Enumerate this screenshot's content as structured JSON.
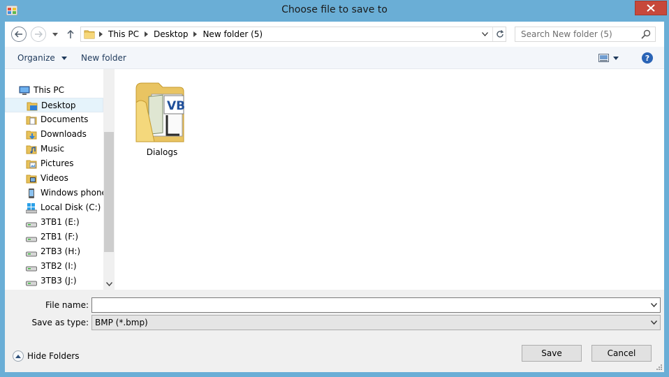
{
  "window": {
    "title": "Choose file to save to"
  },
  "address_bar": {
    "crumbs": [
      "This PC",
      "Desktop",
      "New folder (5)"
    ]
  },
  "search": {
    "placeholder": "Search New folder (5)"
  },
  "toolbar": {
    "organize_label": "Organize",
    "new_folder_label": "New folder"
  },
  "nav_tree": {
    "root": {
      "label": "This PC",
      "icon": "computer-icon"
    },
    "items": [
      {
        "label": "Desktop",
        "icon": "desktop-folder-icon",
        "selected": true
      },
      {
        "label": "Documents",
        "icon": "documents-folder-icon"
      },
      {
        "label": "Downloads",
        "icon": "downloads-folder-icon"
      },
      {
        "label": "Music",
        "icon": "music-folder-icon"
      },
      {
        "label": "Pictures",
        "icon": "pictures-folder-icon"
      },
      {
        "label": "Videos",
        "icon": "videos-folder-icon"
      },
      {
        "label": "Windows phone",
        "icon": "phone-icon"
      },
      {
        "label": "Local Disk (C:)",
        "icon": "system-drive-icon"
      },
      {
        "label": "3TB1 (E:)",
        "icon": "drive-icon"
      },
      {
        "label": "2TB1 (F:)",
        "icon": "drive-icon"
      },
      {
        "label": "2TB3 (H:)",
        "icon": "drive-icon"
      },
      {
        "label": "3TB2 (I:)",
        "icon": "drive-icon"
      },
      {
        "label": "3TB3 (J:)",
        "icon": "drive-icon"
      }
    ]
  },
  "files": [
    {
      "name": "Dialogs",
      "icon": "folder-icon"
    }
  ],
  "form": {
    "file_name_label": "File name:",
    "file_name_value": "",
    "save_type_label": "Save as type:",
    "save_type_value": "BMP (*.bmp)"
  },
  "footer": {
    "hide_folders_label": "Hide Folders",
    "save_label": "Save",
    "cancel_label": "Cancel"
  },
  "colors": {
    "frame": "#6aaed6",
    "close_button": "#c7483b",
    "selection": "#e5f3fb"
  }
}
